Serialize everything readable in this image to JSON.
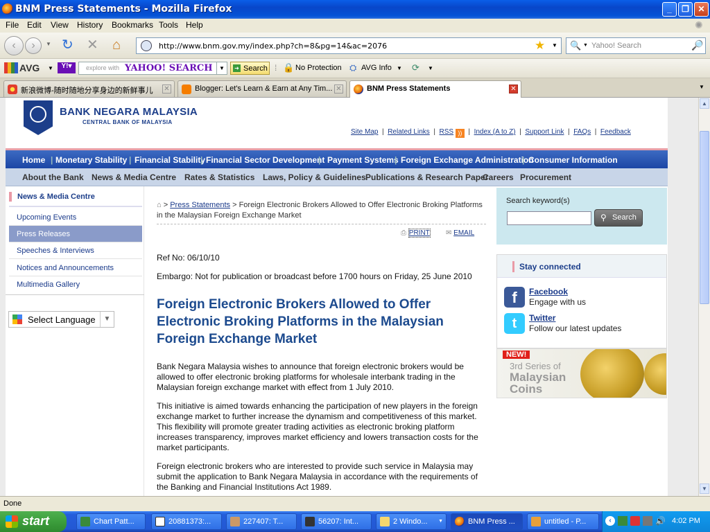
{
  "window": {
    "title": "BNM Press Statements - Mozilla Firefox"
  },
  "menu": [
    "File",
    "Edit",
    "View",
    "History",
    "Bookmarks",
    "Tools",
    "Help"
  ],
  "navbar": {
    "url": "http://www.bnm.gov.my/index.php?ch=8&pg=14&ac=2076",
    "search_placeholder": "Yahoo! Search"
  },
  "avgbar": {
    "avg_label": "AVG",
    "yahoo_placeholder": "explore with",
    "yahoo_brand": "YAHOO! SEARCH",
    "search_button": "Search",
    "protection": "No Protection",
    "avg_info": "AVG Info"
  },
  "tabs": [
    {
      "label": "新浪微博-随时随地分享身边的新鲜事儿"
    },
    {
      "label": "Blogger: Let's Learn & Earn at Any Tim..."
    },
    {
      "label": "BNM Press Statements"
    }
  ],
  "site": {
    "logo_title": "BANK NEGARA MALAYSIA",
    "logo_subtitle": "CENTRAL BANK OF MALAYSIA",
    "toplinks": [
      "Site Map",
      "Related Links",
      "RSS",
      "Index (A to Z)",
      "Support Link",
      "FAQs",
      "Feedback"
    ],
    "mainnav": [
      "Home",
      "Monetary Stability",
      "Financial Stability",
      "Financial Sector Development",
      "Payment Systems",
      "Foreign Exchange Administration",
      "Consumer Information"
    ],
    "subnav": [
      "About the Bank",
      "News & Media Centre",
      "Rates & Statistics",
      "Laws, Policy & Guidelines",
      "Publications & Research Paper",
      "Careers",
      "Procurement"
    ]
  },
  "sidebar": {
    "heading": "News & Media Centre",
    "items": [
      "Upcoming Events",
      "Press Releases",
      "Speeches & Interviews",
      "Notices and Announcements",
      "Multimedia Gallery"
    ],
    "language": "Select Language"
  },
  "article": {
    "breadcrumb_link": "Press Statements",
    "breadcrumb_rest": " > Foreign Electronic Brokers Allowed to Offer Electronic Broking Platforms in the Malaysian Foreign Exchange Market",
    "print": "PRINT",
    "email": "EMAIL",
    "ref": "Ref No: 06/10/10",
    "embargo": "Embargo: Not for publication or broadcast before 1700 hours on Friday, 25 June 2010",
    "title": "Foreign Electronic Brokers Allowed to Offer Electronic Broking Platforms in the Malaysian Foreign Exchange Market",
    "p1": "Bank Negara Malaysia wishes to announce that foreign electronic brokers would be allowed to offer electronic broking platforms for wholesale interbank trading in the Malaysian foreign exchange market with effect from 1 July 2010.",
    "p2": "This initiative is aimed towards enhancing the participation of new players in the foreign exchange market to further increase the dynamism and competitiveness of this market. This flexibility will promote greater trading activities as electronic broking platform increases transparency, improves market efficiency and lowers transaction costs for the market participants.",
    "p3": "Foreign electronic brokers who are interested to provide such service in Malaysia may submit the application to Bank Negara Malaysia in accordance with the requirements of the Banking and Financial Institutions Act 1989."
  },
  "rightpanel": {
    "search_label": "Search keyword(s)",
    "search_button": "Search",
    "stay_connected": "Stay connected",
    "facebook": "Facebook",
    "facebook_sub": "Engage with us",
    "twitter": "Twitter",
    "twitter_sub": "Follow our latest updates",
    "banner_new": "NEW!",
    "banner_line1": "3rd Series of",
    "banner_line2": "Malaysian",
    "banner_line3": "Coins"
  },
  "status": {
    "text": "Done"
  },
  "taskbar": {
    "start": "start",
    "items": [
      "Chart Patt...",
      "20881373:...",
      "227407: T...",
      "56207: Int...",
      "2 Windo...",
      "BNM Press ...",
      "untitled - P..."
    ],
    "clock": "4:02 PM"
  }
}
